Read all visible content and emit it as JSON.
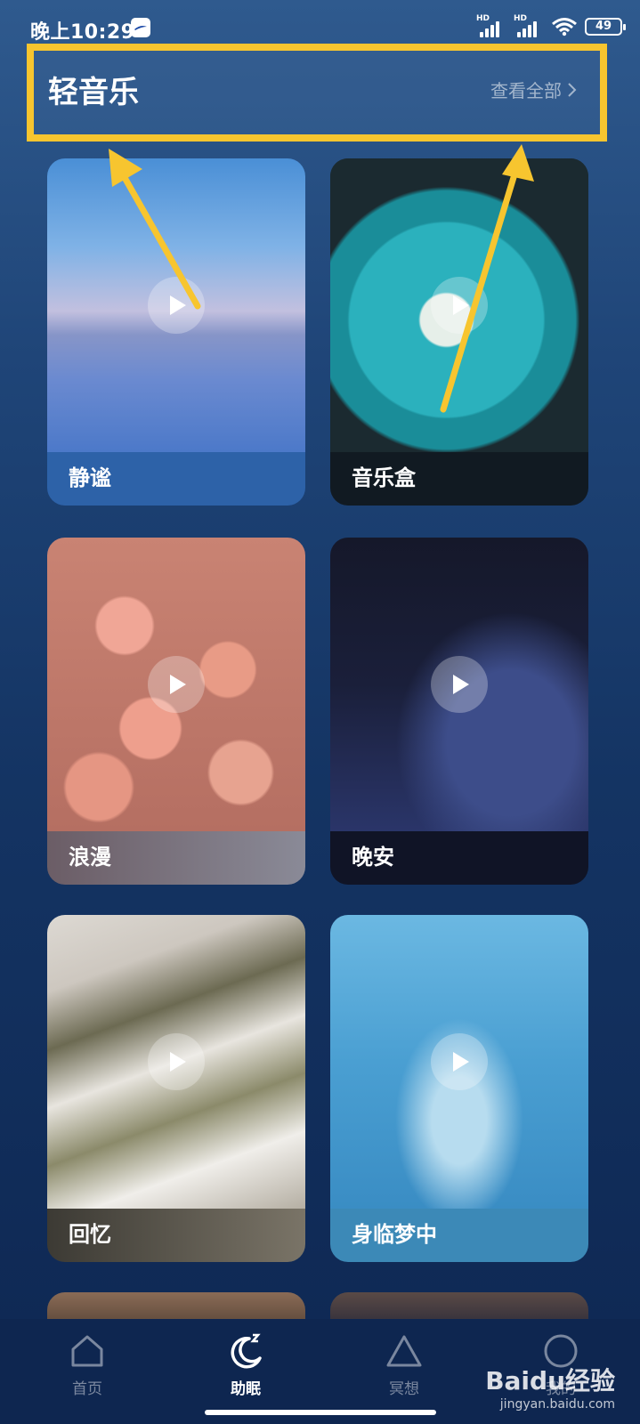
{
  "status_bar": {
    "time": "晚上10:29",
    "signal1_label": "HD",
    "signal2_label": "HD",
    "battery": "49"
  },
  "section": {
    "title": "轻音乐",
    "view_all": "查看全部",
    "view_all_icon": "chevron-right-icon",
    "highlight_color": "#f7c52f"
  },
  "cards": [
    {
      "title": "静谧"
    },
    {
      "title": "音乐盒"
    },
    {
      "title": "浪漫"
    },
    {
      "title": "晚安"
    },
    {
      "title": "回忆"
    },
    {
      "title": "身临梦中"
    }
  ],
  "bottom_nav": {
    "items": [
      {
        "label": "首页",
        "icon": "home-icon",
        "active": false
      },
      {
        "label": "助眠",
        "icon": "moon-sleep-icon",
        "active": true
      },
      {
        "label": "冥想",
        "icon": "triangle-icon",
        "active": false
      },
      {
        "label": "我的",
        "icon": "circle-icon",
        "active": false
      }
    ]
  },
  "watermark": {
    "main": "Baidu经验",
    "sub": "jingyan.baidu.com"
  },
  "colors": {
    "background_top": "#2f5a8e",
    "background_bottom": "#0e2752",
    "annotation": "#f7c52f"
  }
}
